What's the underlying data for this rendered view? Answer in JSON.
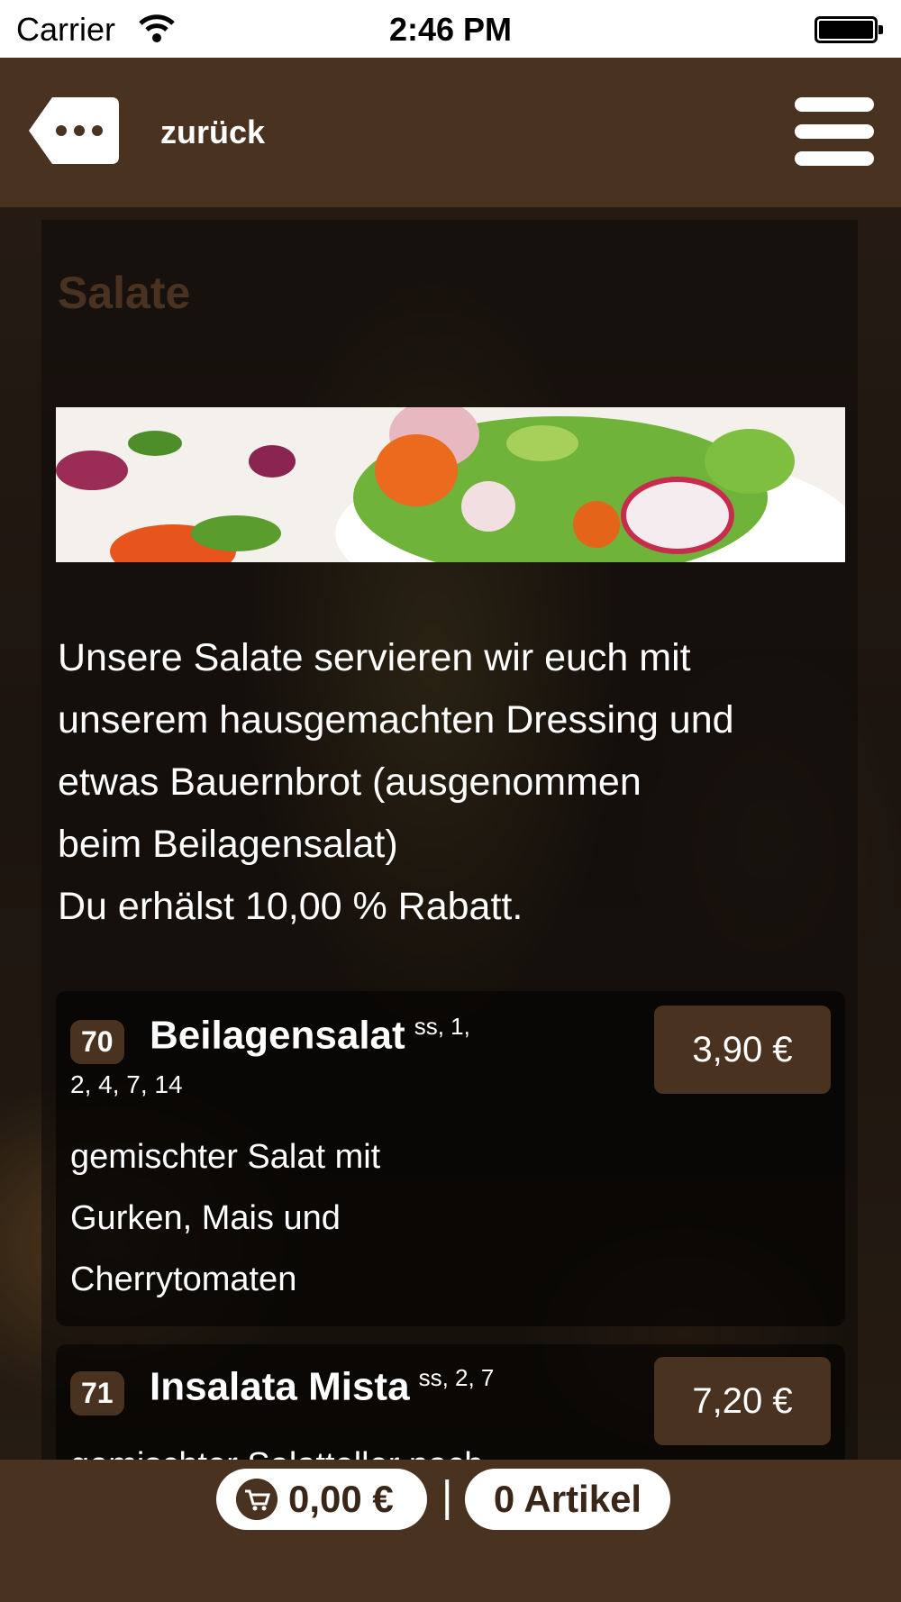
{
  "status_bar": {
    "carrier": "Carrier",
    "time": "2:46 PM"
  },
  "header": {
    "back_label": "zurück"
  },
  "section": {
    "title": "Salate",
    "description_lines": [
      "Unsere Salate servieren wir euch mit",
      "unserem hausgemachten Dressing und",
      "etwas Bauernbrot (ausgenommen",
      "beim Beilagensalat)",
      "Du erhälst 10,00 % Rabatt."
    ]
  },
  "items": [
    {
      "number": "70",
      "name": "Beilagensalat",
      "allergens": "ss, 1,",
      "allergens_line2": "2, 4, 7, 14",
      "price": "3,90 €",
      "description_lines": [
        "gemischter Salat mit",
        "Gurken, Mais und",
        "Cherrytomaten"
      ]
    },
    {
      "number": "71",
      "name": "Insalata Mista",
      "allergens": "ss, 2, 7",
      "price": "7,20 €",
      "description_partial": "gemischter Salatteller nach"
    }
  ],
  "cart": {
    "total": "0,00 €",
    "separator": "|",
    "count_label": "0 Artikel"
  },
  "colors": {
    "brand_brown": "#4a3221",
    "title_brown": "#4a3221"
  },
  "icons": {
    "back": "more-dots-icon",
    "menu": "hamburger-icon",
    "cart": "cart-icon"
  }
}
